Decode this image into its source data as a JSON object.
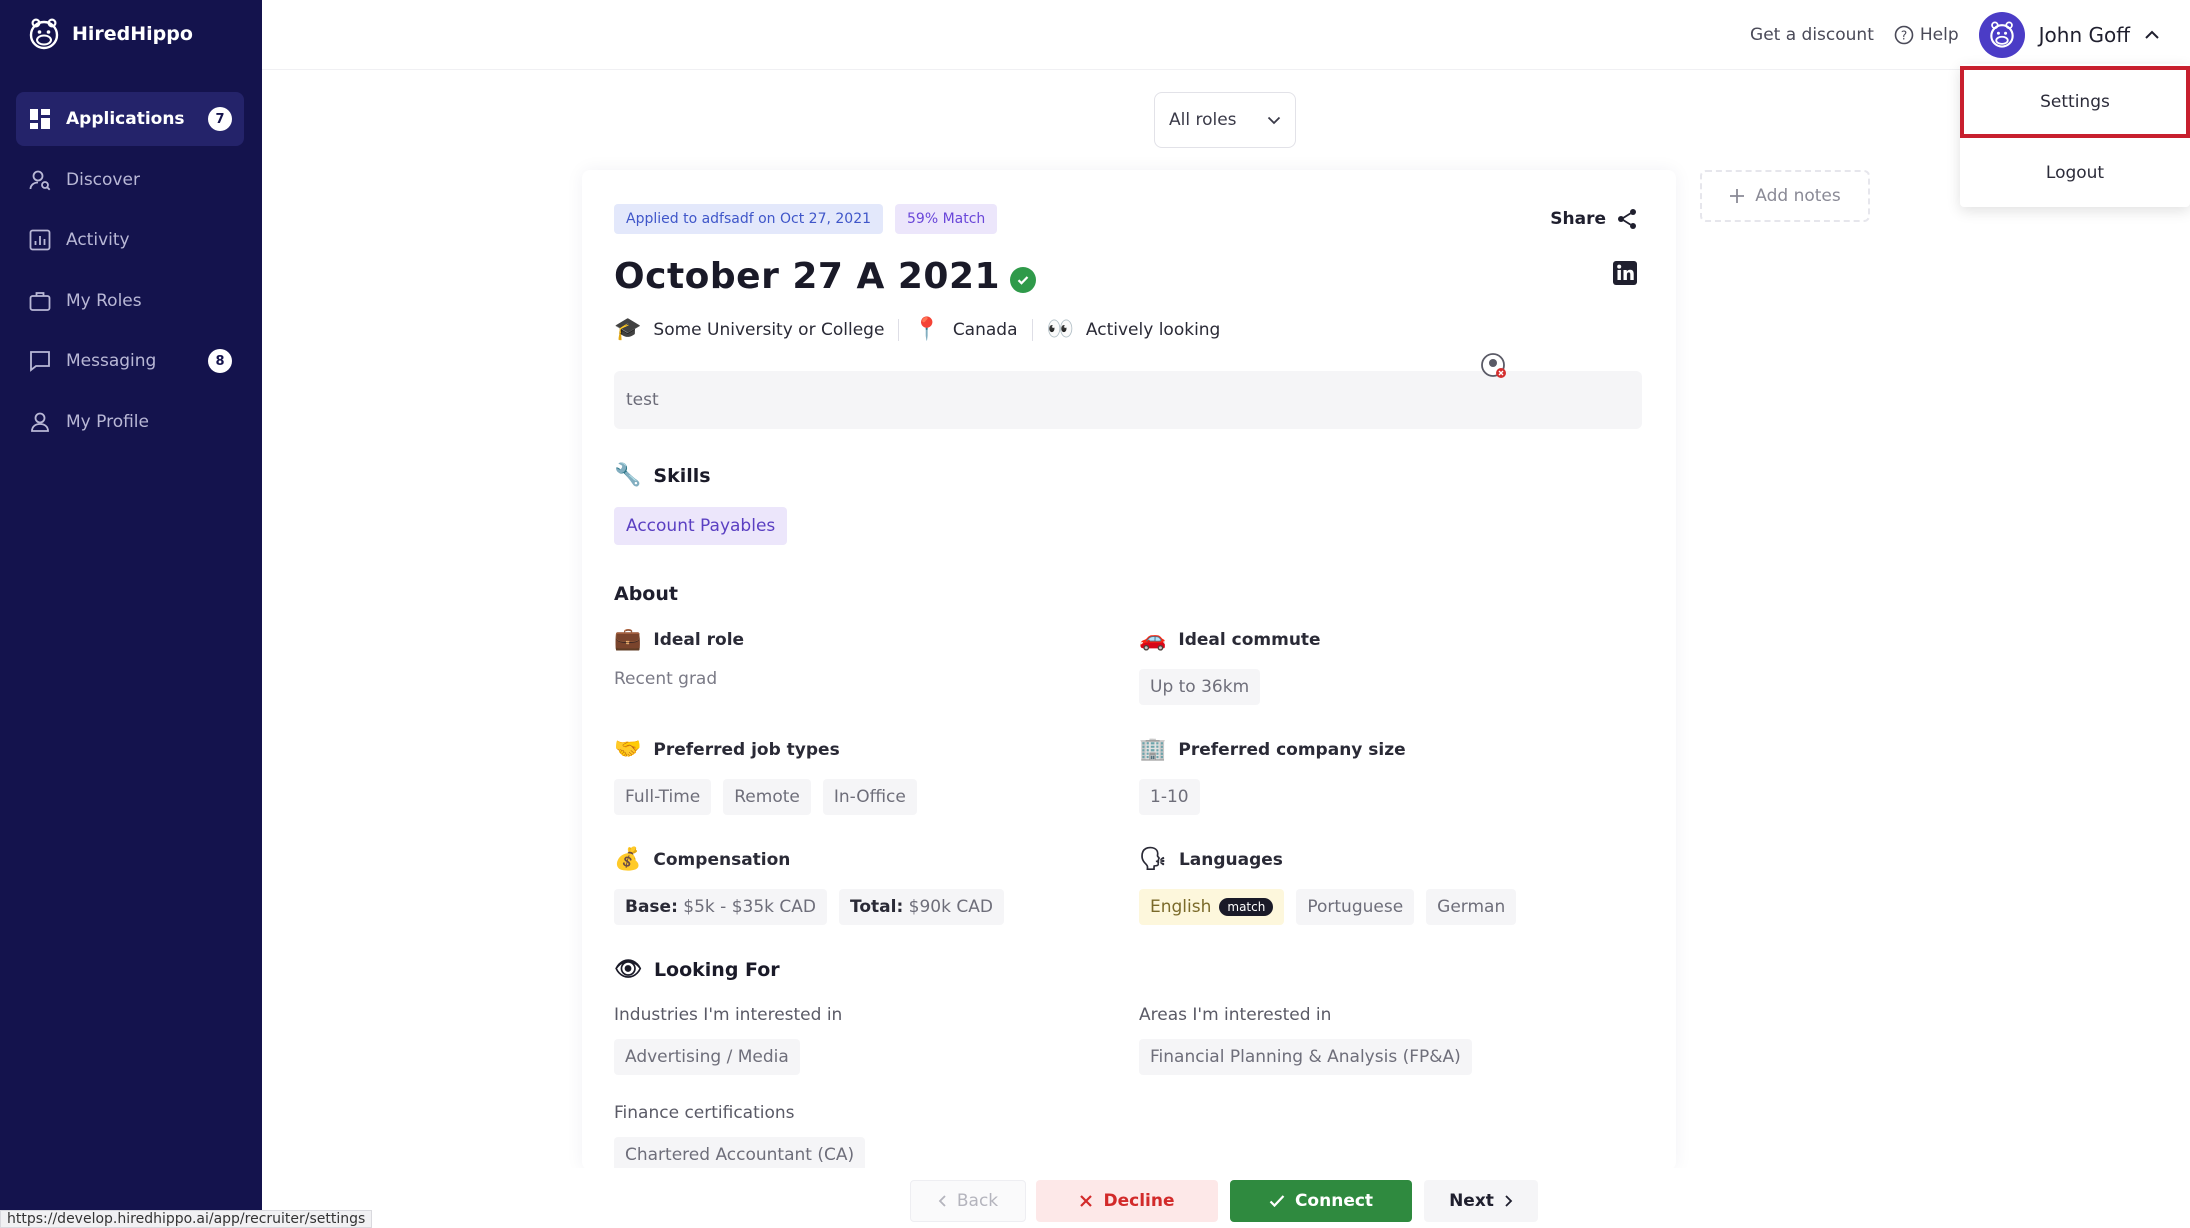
{
  "brand": {
    "name": "HiredHippo"
  },
  "sidebar": {
    "items": [
      {
        "label": "Applications",
        "badge": "7",
        "icon": "grid-icon",
        "active": true
      },
      {
        "label": "Discover",
        "icon": "user-search-icon"
      },
      {
        "label": "Activity",
        "icon": "chart-icon"
      },
      {
        "label": "My Roles",
        "icon": "briefcase-icon"
      },
      {
        "label": "Messaging",
        "badge": "8",
        "icon": "chat-icon"
      },
      {
        "label": "My Profile",
        "icon": "person-icon"
      }
    ]
  },
  "topbar": {
    "discount": "Get a discount",
    "help": "Help",
    "user_name": "John Goff"
  },
  "menu": {
    "settings": "Settings",
    "logout": "Logout"
  },
  "role_select": {
    "value": "All roles"
  },
  "add_notes": "Add notes",
  "candidate": {
    "applied": "Applied to adfsadf on Oct 27, 2021",
    "match": "59% Match",
    "share": "Share",
    "name": "October 27 A 2021",
    "school": "Some University or College",
    "location": "Canada",
    "status": "Actively looking",
    "bio": "test"
  },
  "skills": {
    "title": "Skills",
    "items": [
      "Account Payables"
    ]
  },
  "about": {
    "title": "About",
    "ideal_role": {
      "label": "Ideal role",
      "value": "Recent grad"
    },
    "ideal_commute": {
      "label": "Ideal commute",
      "value": "Up to 36km"
    },
    "job_types": {
      "label": "Preferred job types",
      "items": [
        "Full-Time",
        "Remote",
        "In-Office"
      ]
    },
    "company_size": {
      "label": "Preferred company size",
      "value": "1-10"
    },
    "compensation": {
      "label": "Compensation",
      "base_label": "Base:",
      "base_value": "$5k - $35k CAD",
      "total_label": "Total:",
      "total_value": "$90k CAD"
    },
    "languages": {
      "label": "Languages",
      "matched": "English",
      "match_tag": "match",
      "others": [
        "Portuguese",
        "German"
      ]
    }
  },
  "looking_for": {
    "title": "Looking For",
    "industries_label": "Industries I'm interested in",
    "industries": [
      "Advertising / Media"
    ],
    "areas_label": "Areas I'm interested in",
    "areas": [
      "Financial Planning & Analysis (FP&A)"
    ],
    "certs_label": "Finance certifications",
    "certs": [
      "Chartered Accountant (CA)"
    ]
  },
  "actions": {
    "back": "Back",
    "decline": "Decline",
    "connect": "Connect",
    "next": "Next"
  },
  "status_url": "https://develop.hiredhippo.ai/app/recruiter/settings"
}
